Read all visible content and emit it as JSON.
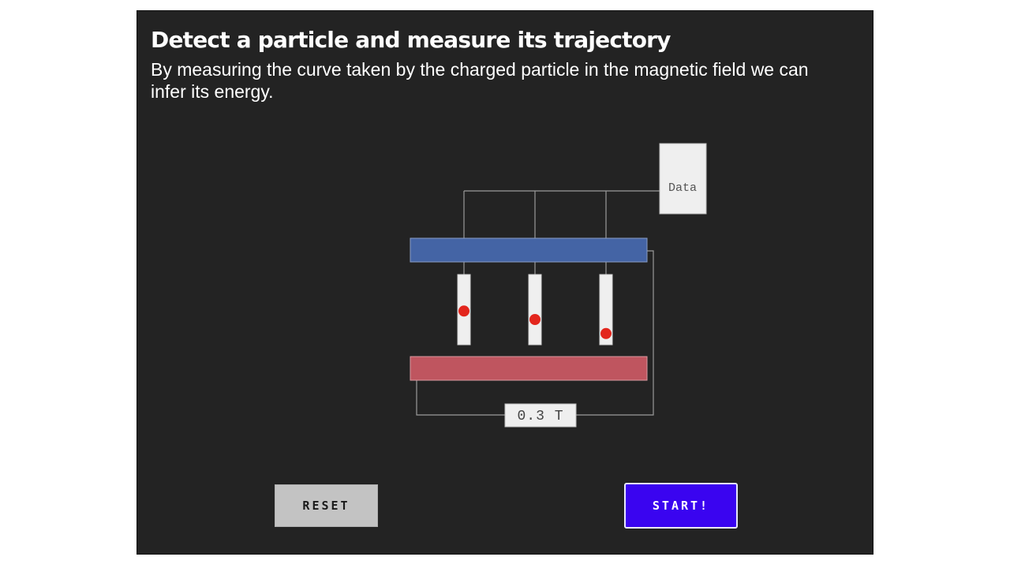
{
  "header": {
    "title": "Detect a particle and measure its trajectory",
    "subtitle": "By measuring the curve taken by the charged particle in the magnetic field we can infer its energy."
  },
  "diagram": {
    "data_box_label": "Data",
    "field_value": "0.3 T",
    "detectors": [
      {
        "hit_level": 0.52
      },
      {
        "hit_level": 0.64
      },
      {
        "hit_level": 0.84
      }
    ],
    "colors": {
      "top_magnet": "#4464a5",
      "bottom_magnet": "#bf555f",
      "hit_dot": "#e3261d",
      "wire": "#9a9a9a"
    }
  },
  "controls": {
    "reset_label": "RESET",
    "start_label": "START!"
  }
}
